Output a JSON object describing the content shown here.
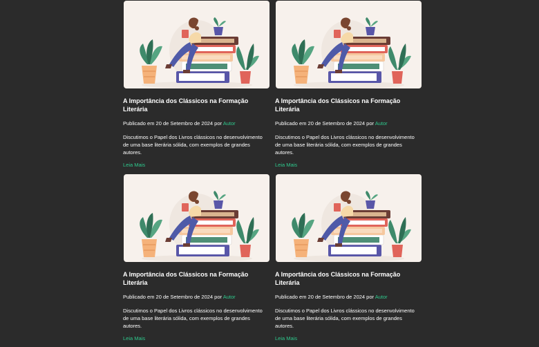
{
  "posts": [
    {
      "image": "reading-illustration",
      "title": "A Importância dos Clássicos na Formação Literária",
      "meta_prefix": "Publicado em 20 de Setembro de 2024 por ",
      "author": "Autor",
      "excerpt": "Discutimos o Papel dos Livros clássicos no desenvolvimento de uma base literária sólida, com exemplos de grandes autores.",
      "read_more": "Leia Mais"
    },
    {
      "image": "reading-illustration",
      "title": "A Importância dos Clássicos na Formação Literária",
      "meta_prefix": "Publicado em 20 de Setembro de 2024 por ",
      "author": "Autor",
      "excerpt": "Discutimos o Papel dos Livros clássicos no desenvolvimento de uma base literária sólida, com exemplos de grandes autores.",
      "read_more": "Leia Mais"
    },
    {
      "image": "reading-illustration",
      "title": "A Importância dos Clássicos na Formação Literária",
      "meta_prefix": "Publicado em 20 de Setembro de 2024 por ",
      "author": "Autor",
      "excerpt": "Discutimos o Papel dos Livros clássicos no desenvolvimento de uma base literária sólida, com exemplos de grandes autores.",
      "read_more": "Leia Mais"
    },
    {
      "image": "reading-illustration",
      "title": "A Importância dos Clássicos na Formação Literária",
      "meta_prefix": "Publicado em 20 de Setembro de 2024 por ",
      "author": "Autor",
      "excerpt": "Discutimos o Papel dos Livros clássicos no desenvolvimento de uma base literária sólida, com exemplos de grandes autores.",
      "read_more": "Leia Mais"
    }
  ],
  "colors": {
    "background": "#2b2b2b",
    "accent": "#2ec98d",
    "card_image_bg": "#f7f1ec"
  }
}
